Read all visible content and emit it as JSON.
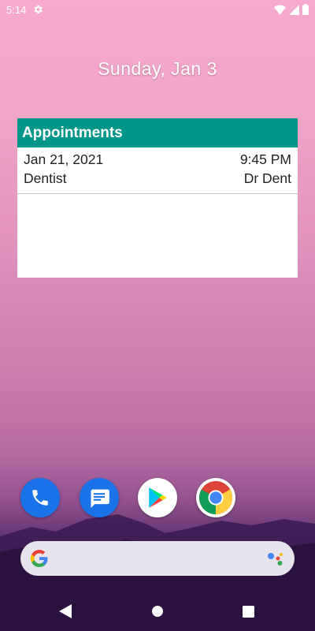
{
  "status_bar": {
    "time": "5:14"
  },
  "home": {
    "date": "Sunday, Jan 3"
  },
  "widget": {
    "title": "Appointments",
    "appointments": [
      {
        "date": "Jan 21, 2021",
        "time": "9:45 PM",
        "title": "Dentist",
        "doctor": "Dr Dent"
      }
    ]
  },
  "dock": {
    "apps": [
      "phone-icon",
      "messages-icon",
      "play-store-icon",
      "chrome-icon"
    ]
  },
  "search": {
    "placeholder": ""
  },
  "colors": {
    "widget_header": "#009688",
    "dock_blue": "#1a73e8"
  }
}
